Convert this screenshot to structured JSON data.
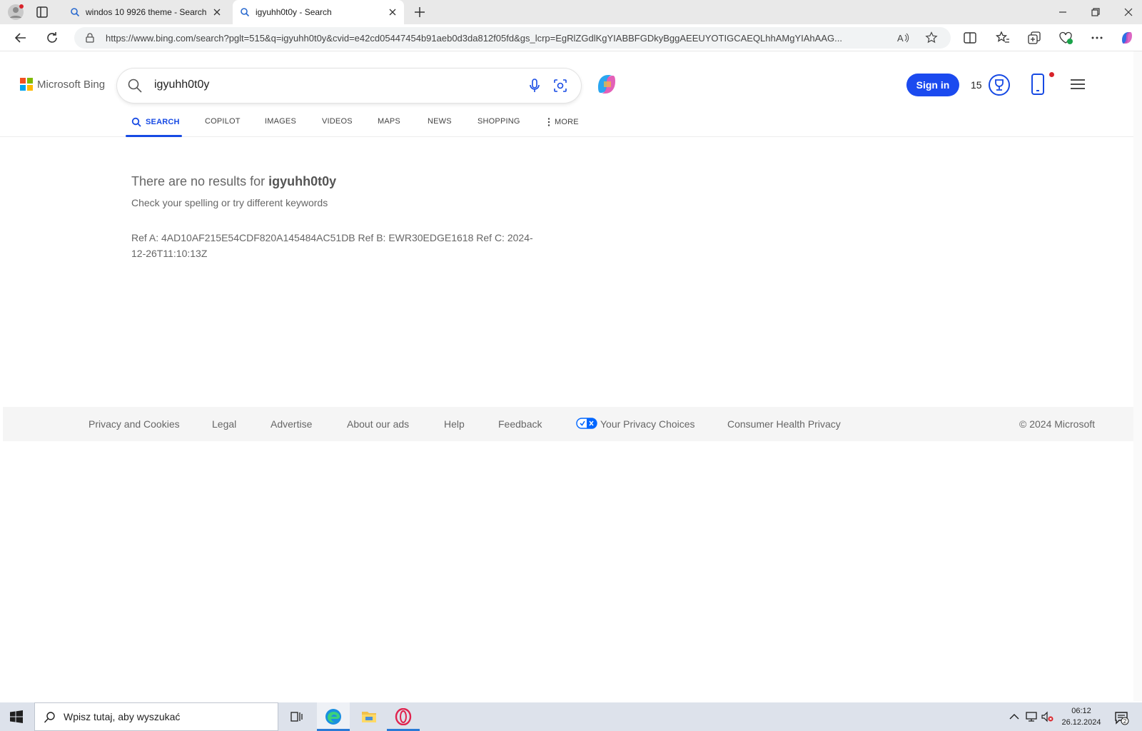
{
  "browser": {
    "tabs": [
      {
        "title": "windos 10 9926 theme - Search"
      },
      {
        "title": "igyuhh0t0y - Search"
      }
    ],
    "url": "https://www.bing.com/search?pglt=515&q=igyuhh0t0y&cvid=e42cd05447454b91aeb0d3da812f05fd&gs_lcrp=EgRlZGdlKgYIABBFGDkyBggAEEUYOTIGCAEQLhhAMgYIAhAAG..."
  },
  "bing": {
    "brand": "Microsoft Bing",
    "query": "igyuhh0t0y",
    "signin": "Sign in",
    "rewards_points": "15",
    "nav": [
      {
        "label": "SEARCH"
      },
      {
        "label": "COPILOT"
      },
      {
        "label": "IMAGES"
      },
      {
        "label": "VIDEOS"
      },
      {
        "label": "MAPS"
      },
      {
        "label": "NEWS"
      },
      {
        "label": "SHOPPING"
      },
      {
        "label": "MORE"
      }
    ],
    "no_results_prefix": "There are no results for",
    "no_results_query": "igyuhh0t0y",
    "hint": "Check your spelling or try different keywords",
    "ref": "Ref A: 4AD10AF215E54CDF820A145484AC51DB Ref B: EWR30EDGE1618 Ref C: 2024-12-26T11:10:13Z"
  },
  "footer": {
    "links": [
      {
        "label": "Privacy and Cookies"
      },
      {
        "label": "Legal"
      },
      {
        "label": "Advertise"
      },
      {
        "label": "About our ads"
      },
      {
        "label": "Help"
      },
      {
        "label": "Feedback"
      },
      {
        "label": "Your Privacy Choices"
      },
      {
        "label": "Consumer Health Privacy"
      }
    ],
    "copyright": "© 2024 Microsoft"
  },
  "taskbar": {
    "search_placeholder": "Wpisz tutaj, aby wyszukać",
    "time": "06:12",
    "date": "26.12.2024",
    "notification_count": "2"
  },
  "colors": {
    "accent": "#174ae4",
    "signin": "#1b4aef"
  }
}
